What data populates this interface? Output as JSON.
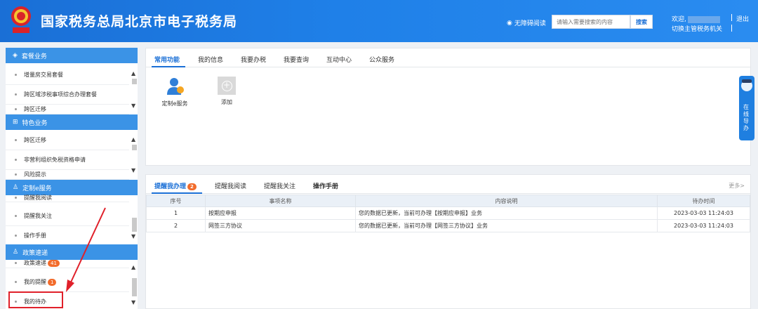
{
  "header": {
    "title": "国家税务总局北京市电子税务局",
    "accessibility_label": "无障碍阅读",
    "search_placeholder": "请输入需要搜索的内容",
    "search_button": "搜索",
    "welcome": "欢迎,",
    "switch_org": "切换主管税务机关",
    "logout": "退出"
  },
  "sidebar": {
    "sections": [
      {
        "title": "套餐业务",
        "icon": "layers-icon",
        "items": [
          "增量房交易套餐",
          "跨区域涉税事项综合办理套餐",
          "跨区迁移"
        ]
      },
      {
        "title": "特色业务",
        "icon": "grid-icon",
        "items": [
          "跨区迁移",
          "非营利组织免税资格申请",
          "风险提示"
        ]
      },
      {
        "title": "定制e服务",
        "icon": "user-icon",
        "items": [
          "提醒我阅读",
          "提醒我关注",
          "操作手册"
        ]
      },
      {
        "title": "政策速递",
        "icon": "user-icon",
        "items": [
          "政策速递",
          "我的提醒",
          "我的待办"
        ]
      }
    ],
    "policy_badge": "41",
    "reminder_badge": "1"
  },
  "panel1": {
    "tabs": [
      "常用功能",
      "我的信息",
      "我要办税",
      "我要查询",
      "互动中心",
      "公众服务"
    ],
    "active_tab": "常用功能",
    "apps": [
      {
        "label": "定制e服务",
        "icon": "user-service-icon"
      },
      {
        "label": "添加",
        "icon": "add-icon"
      }
    ]
  },
  "panel2": {
    "tabs": [
      "提醒我办理",
      "提醒我阅读",
      "提醒我关注",
      "操作手册"
    ],
    "todo_badge": "2",
    "more": "更多>",
    "columns": [
      "序号",
      "事项名称",
      "内容说明",
      "待办时间"
    ],
    "rows": [
      [
        "1",
        "按期应申报",
        "您的数据已更新，当前可办理【按期应申报】业务",
        "2023-03-03 11:24:03"
      ],
      [
        "2",
        "网签三方协议",
        "您的数据已更新，当前可办理【网签三方协议】业务",
        "2023-03-03 11:24:03"
      ]
    ]
  },
  "float_widget": {
    "label": "在线导办"
  },
  "colors": {
    "header_blue": "#1a6fd6",
    "section_blue": "#3b93e6",
    "badge_orange": "#f26b2b",
    "annotation_red": "#e0202a"
  }
}
